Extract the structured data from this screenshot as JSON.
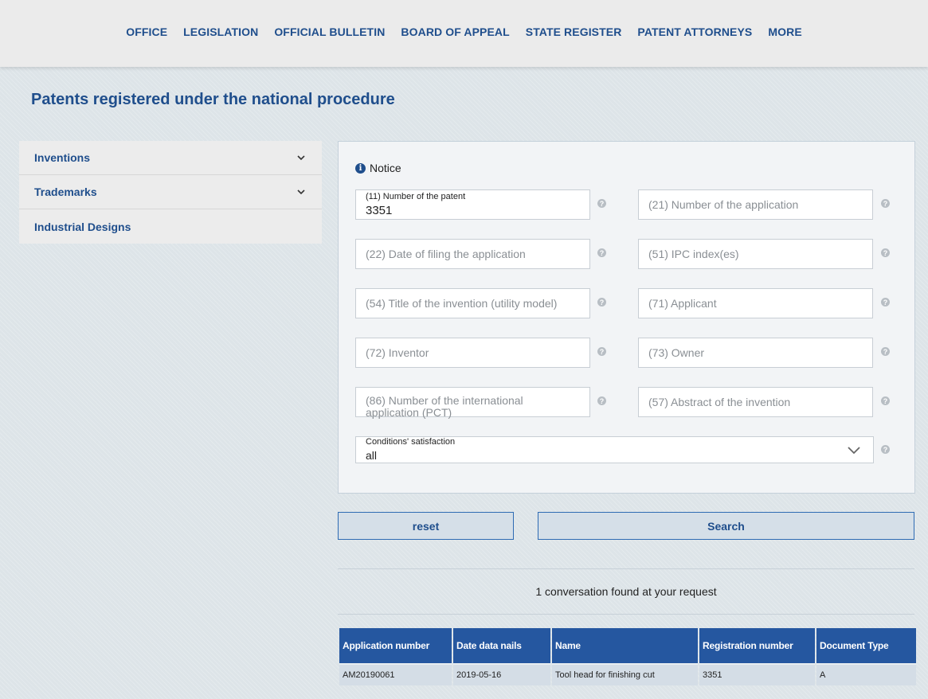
{
  "nav": {
    "items": [
      "OFFICE",
      "LEGISLATION",
      "OFFICIAL BULLETIN",
      "BOARD OF APPEAL",
      "STATE REGISTER",
      "PATENT ATTORNEYS",
      "MORE"
    ]
  },
  "page": {
    "title": "Patents registered under the national procedure"
  },
  "sidebar": {
    "items": [
      {
        "label": "Inventions"
      },
      {
        "label": "Trademarks"
      },
      {
        "label": "Industrial Designs"
      }
    ]
  },
  "form": {
    "notice": "Notice",
    "fields": {
      "patent_number": {
        "label": "(11) Number of the patent",
        "value": "3351"
      },
      "application_number": {
        "placeholder": "(21) Number of the application"
      },
      "filing_date": {
        "placeholder": "(22) Date of filing the application"
      },
      "ipc_index": {
        "placeholder": "(51) IPC index(es)"
      },
      "invention_title": {
        "placeholder": "(54) Title of the invention (utility model)"
      },
      "applicant": {
        "placeholder": "(71) Applicant"
      },
      "inventor": {
        "placeholder": "(72) Inventor"
      },
      "owner": {
        "placeholder": "(73) Owner"
      },
      "pct_number": {
        "placeholder_line1": "(86) Number of the international",
        "placeholder_line2": "application (PCT)"
      },
      "abstract": {
        "placeholder": "(57) Abstract of the invention"
      }
    },
    "conditions": {
      "label": "Conditions' satisfaction",
      "value": "all"
    },
    "help_glyph": "?",
    "reset_label": "reset",
    "search_label": "Search"
  },
  "results": {
    "summary": "1 conversation found at your request",
    "columns": [
      "Application number",
      "Date data nails",
      "Name",
      "Registration number",
      "Document Type"
    ],
    "rows": [
      [
        "AM20190061",
        "2019-05-16",
        "Tool head for finishing cut",
        "3351",
        "A"
      ]
    ]
  },
  "colors": {
    "accent": "#1f4e8c",
    "table_header": "#2557a0",
    "table_row": "#d4dde6"
  }
}
